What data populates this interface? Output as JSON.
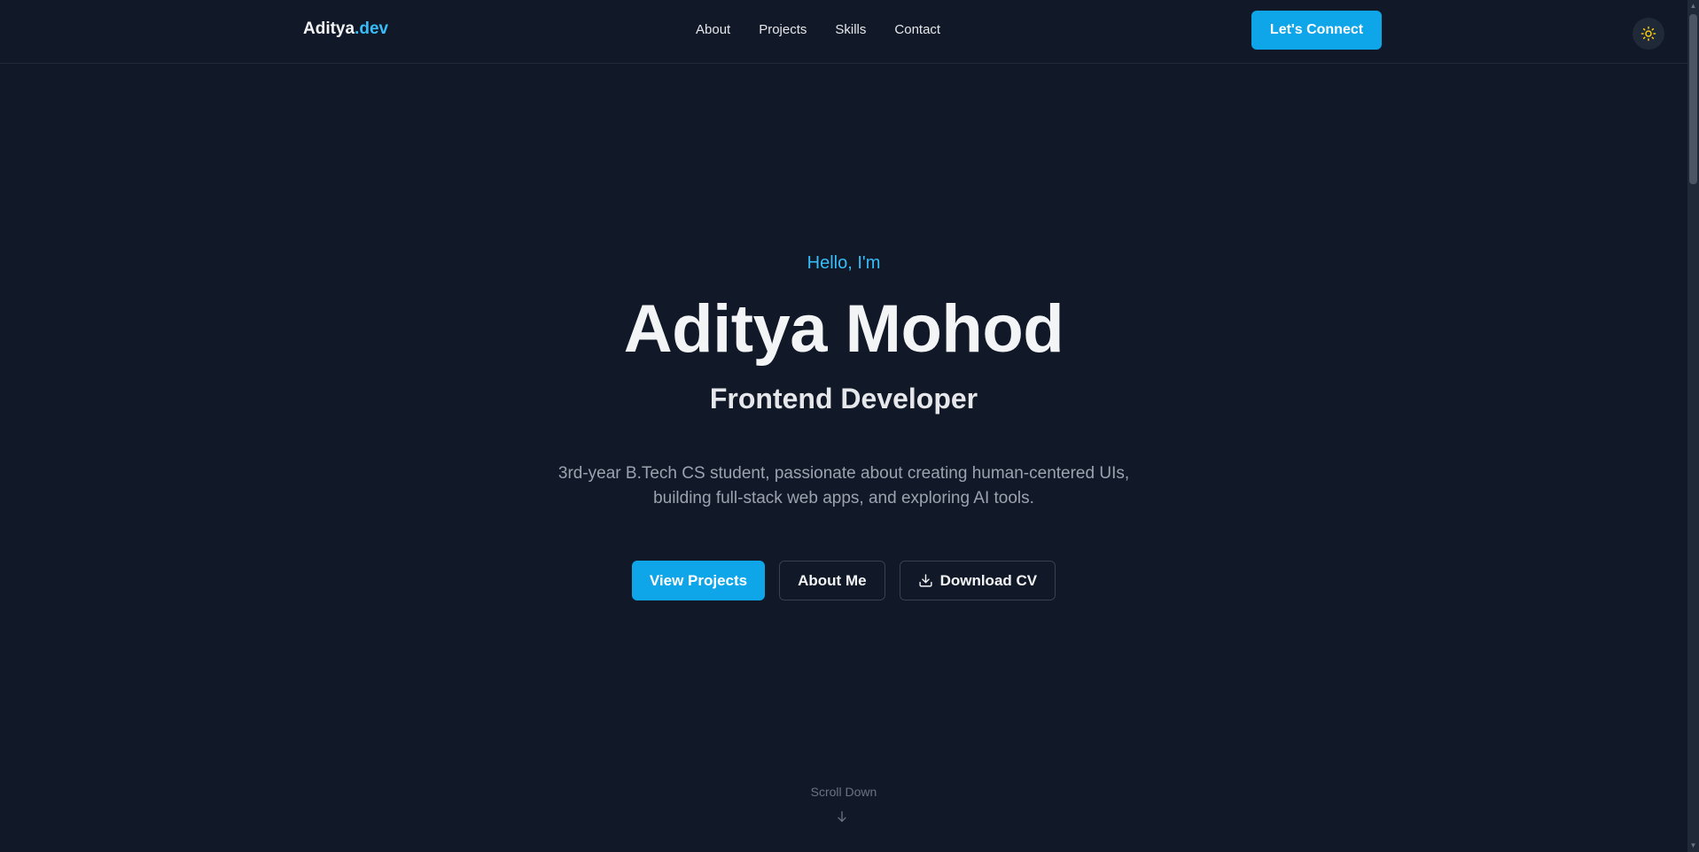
{
  "header": {
    "logo_main": "Aditya",
    "logo_accent": ".dev",
    "nav": [
      {
        "label": "About"
      },
      {
        "label": "Projects"
      },
      {
        "label": "Skills"
      },
      {
        "label": "Contact"
      }
    ],
    "cta_label": "Let's Connect",
    "theme_toggle_icon": "sun-icon"
  },
  "hero": {
    "greeting": "Hello, I'm",
    "name": "Aditya Mohod",
    "role": "Frontend Developer",
    "bio": "3rd-year B.Tech CS student, passionate about creating human-centered UIs, building full-stack web apps, and exploring AI tools.",
    "buttons": {
      "view_projects": "View Projects",
      "about_me": "About Me",
      "download_cv": "Download CV"
    },
    "scroll_hint": "Scroll Down"
  },
  "colors": {
    "background": "#111827",
    "accent": "#0ea5e9",
    "accent_text": "#38bdf8",
    "sun": "#facc15"
  }
}
